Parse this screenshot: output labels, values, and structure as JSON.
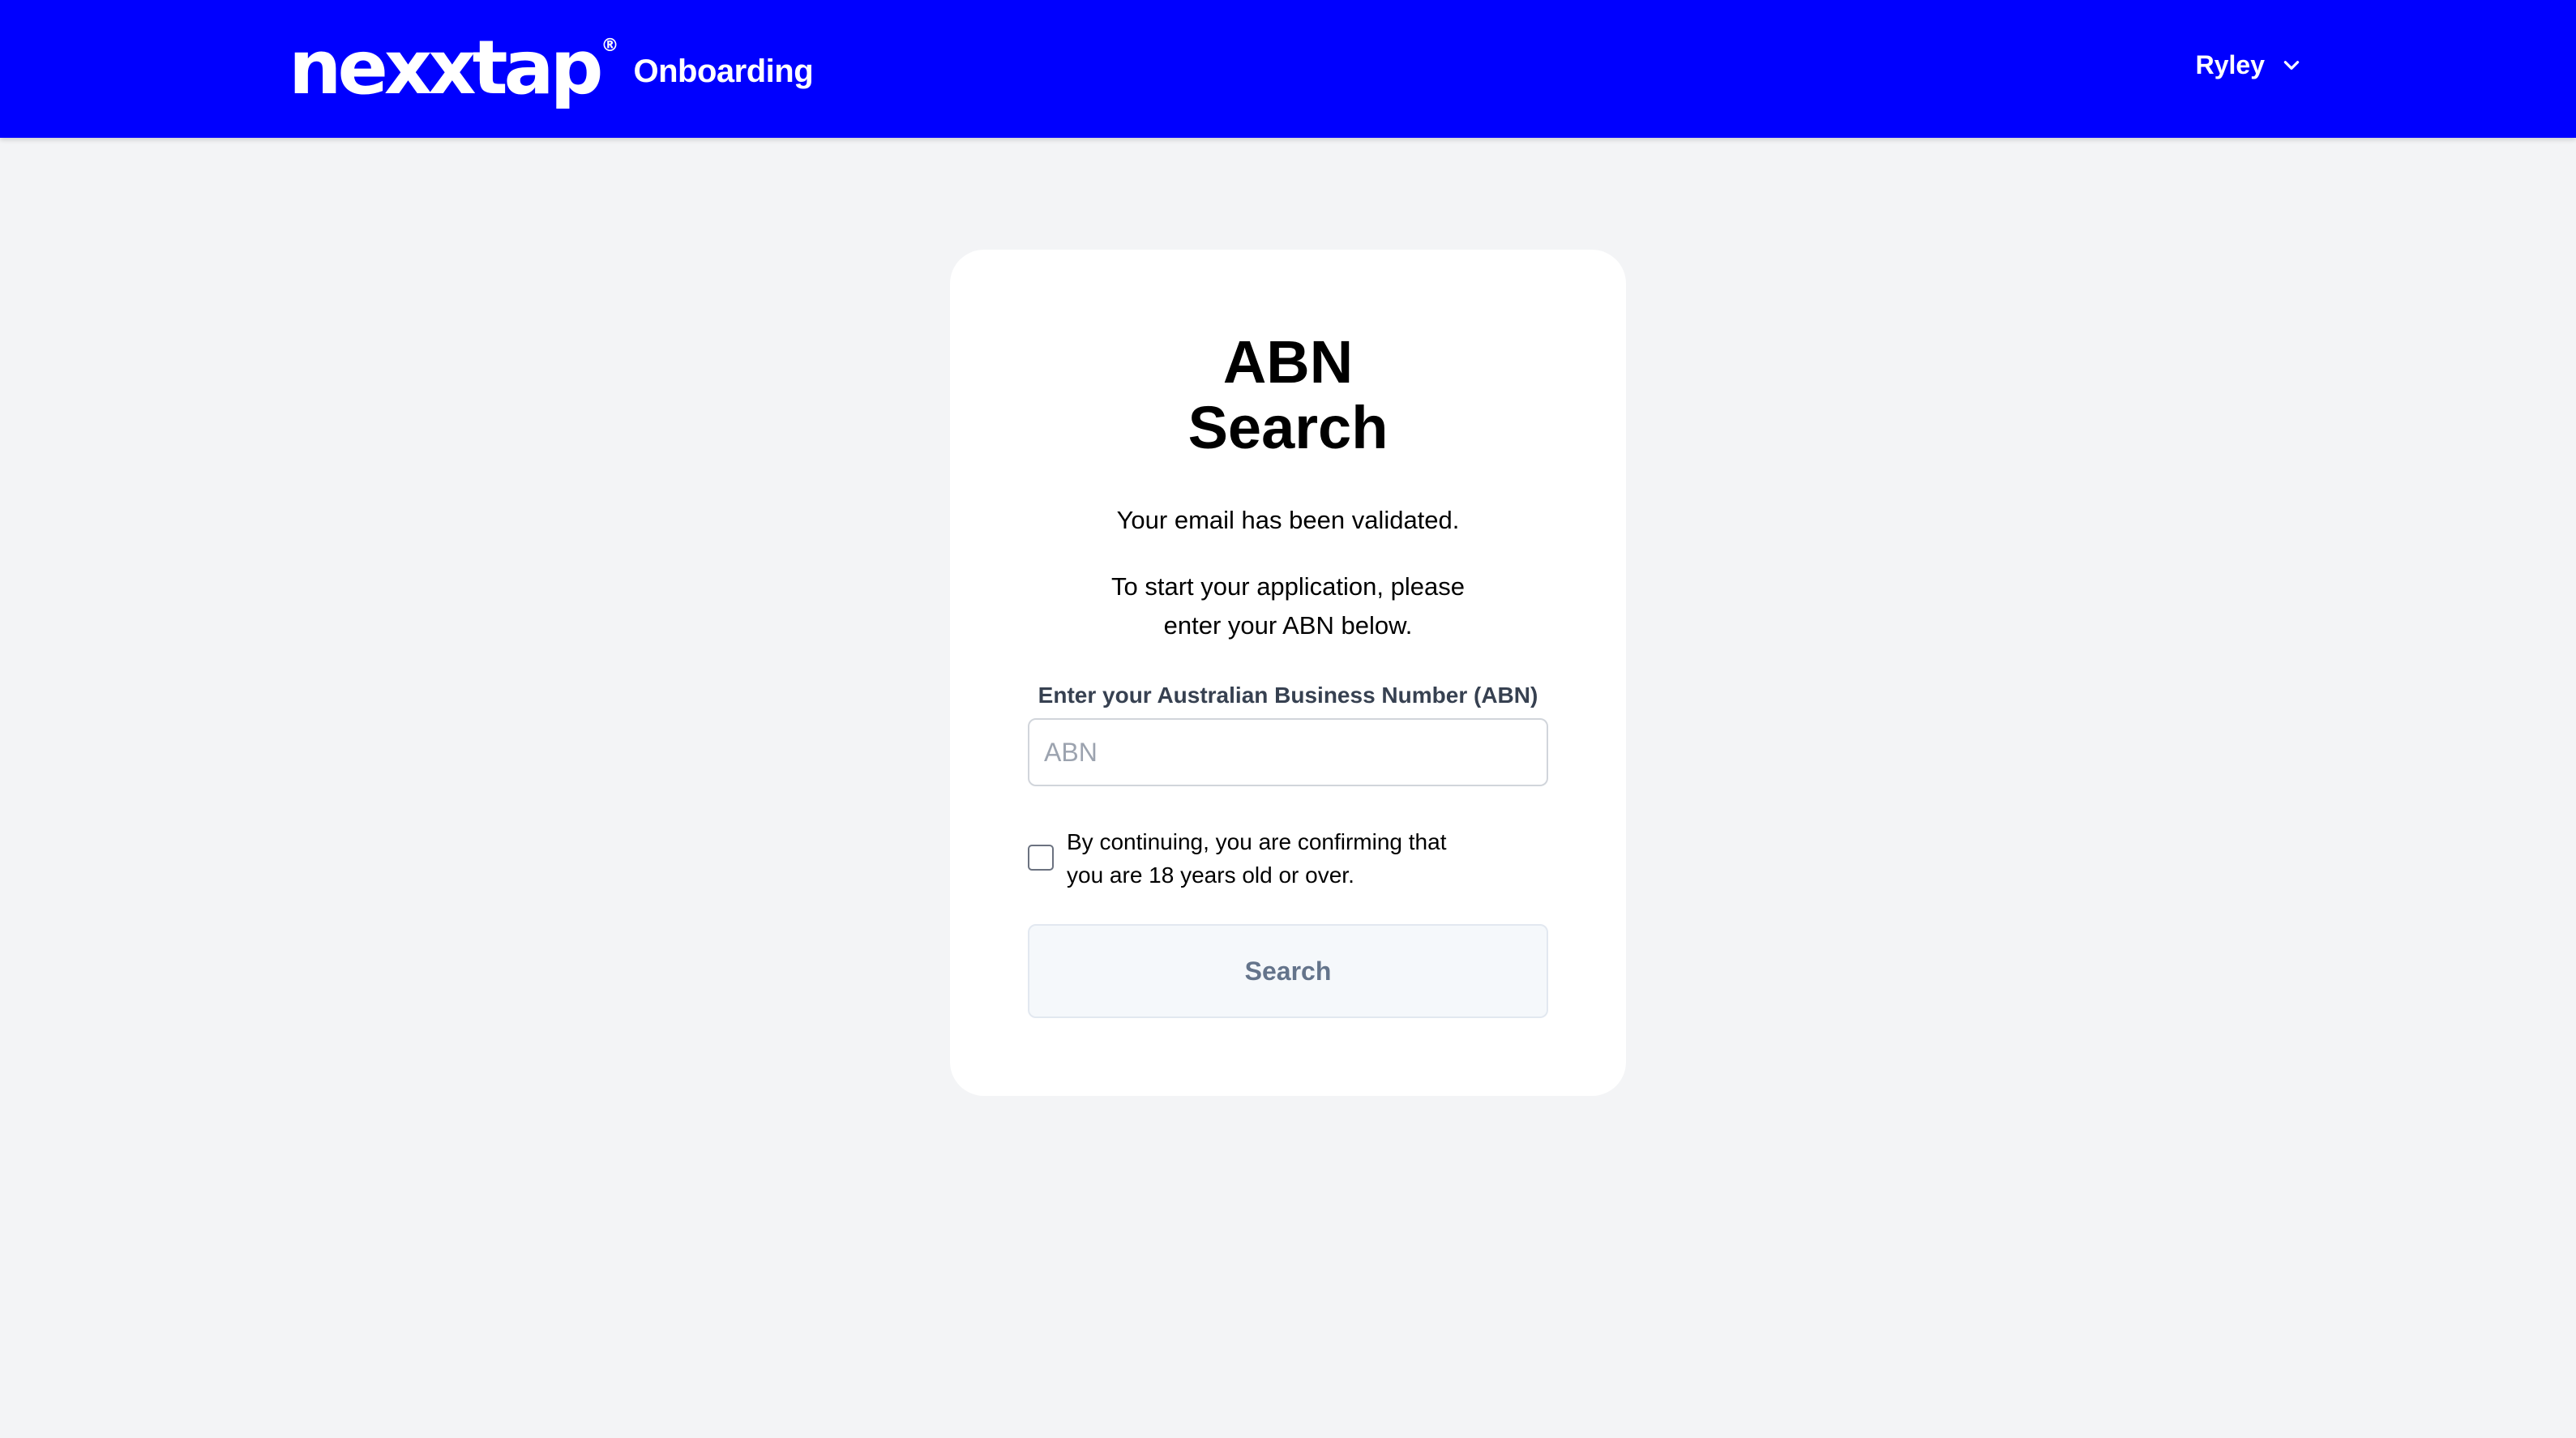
{
  "header": {
    "logo_text": "nexxtap",
    "logo_registered": "®",
    "app_name": "Onboarding",
    "user": {
      "name": "Ryley",
      "menu_icon": "chevron-down-icon"
    }
  },
  "card": {
    "title_line1": "ABN",
    "title_line2": "Search",
    "message": "Your email has been validated.",
    "instructions": "To start your application, please enter your ABN below.",
    "abn_field": {
      "label": "Enter your Australian Business Number (ABN)",
      "placeholder": "ABN",
      "value": ""
    },
    "consent": {
      "text": "By continuing, you are confirming that you are 18 years old or over.",
      "checked": false
    },
    "search_button_label": "Search"
  },
  "colors": {
    "header_bg": "#0000ff",
    "page_bg": "#f3f4f6",
    "card_bg": "#ffffff",
    "label_text": "#374151",
    "button_bg": "#f5f8fb",
    "button_text": "#64748b"
  }
}
